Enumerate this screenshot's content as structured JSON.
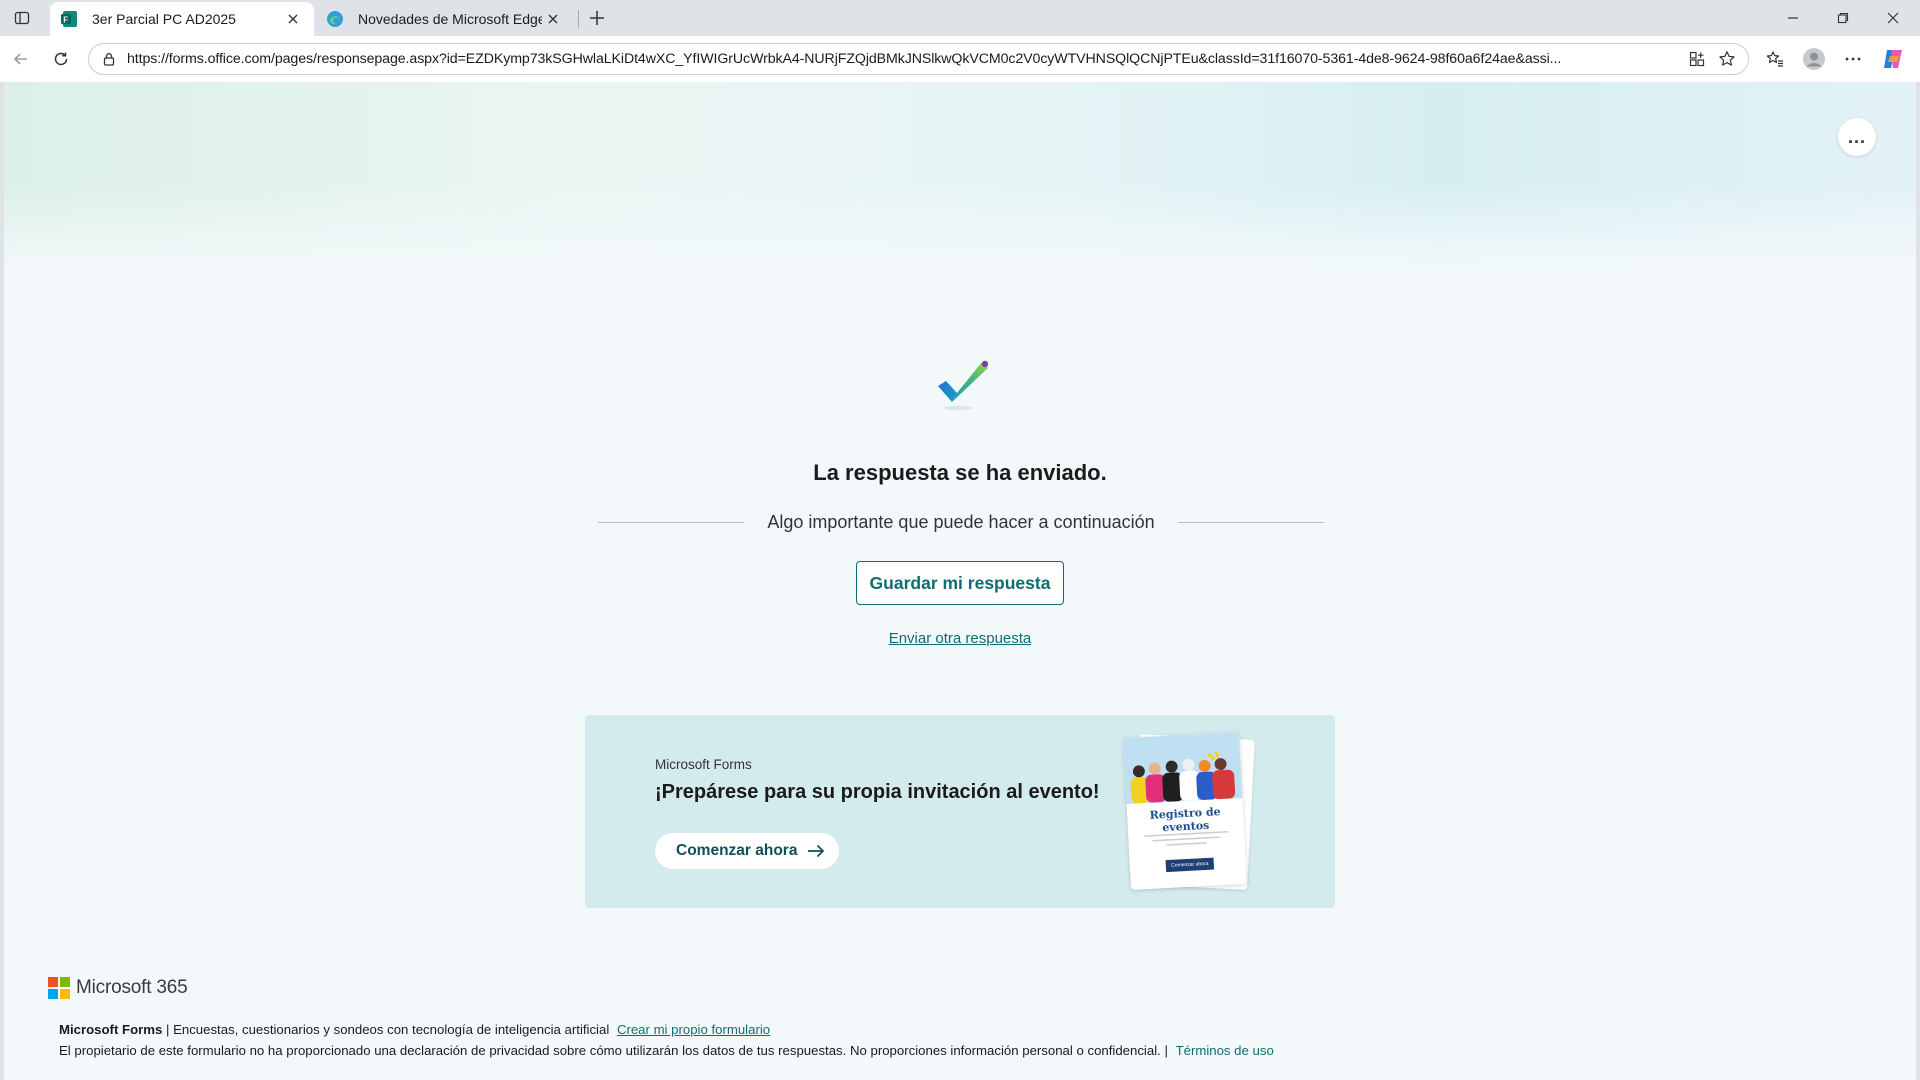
{
  "browser": {
    "tabs": [
      {
        "title": "3er Parcial PC AD2025",
        "favicon": "forms-icon",
        "active": true
      },
      {
        "title": "Novedades de Microsoft Edge",
        "favicon": "edge-icon",
        "active": false
      }
    ],
    "address_bar": {
      "url": "https://forms.office.com/pages/responsepage.aspx?id=EZDKymp73kSGHwlaLKiDt4wXC_YfIWIGrUcWrbkA4-NURjFZQjdBMkJNSlkwQkVCM0c2V0cyWTVHNSQlQCNjPTEu&classId=31f16070-5361-4de8-9624-98f60a6f24ae&assi..."
    },
    "colors": {
      "tabstrip": "#dfe3e8",
      "toolbar": "#ffffff",
      "accent": "#0f6c6f"
    }
  },
  "page": {
    "more_options_label": "...",
    "confirmation": {
      "title": "La respuesta se ha enviado.",
      "subtitle": "Algo importante que puede hacer a continuación",
      "save_button": "Guardar mi respuesta",
      "another_link": "Enviar otra respuesta"
    },
    "promo": {
      "eyebrow": "Microsoft Forms",
      "headline": "¡Prepárese para su propia invitación al evento!",
      "cta": "Comenzar ahora",
      "card_title": "Registro de eventos",
      "card_button": "Comenzar ahora"
    },
    "footer": {
      "brand": "Microsoft 365",
      "product": "Microsoft Forms",
      "tagline": "| Encuestas, cuestionarios y sondeos con tecnología de inteligencia artificial",
      "create_link": "Crear mi propio formulario",
      "privacy_text": "El propietario de este formulario no ha proporcionado una declaración de privacidad sobre cómo utilizarán los datos de tus respuestas. No proporciones información personal o confidencial. |",
      "terms_link": "Términos de uso"
    }
  }
}
